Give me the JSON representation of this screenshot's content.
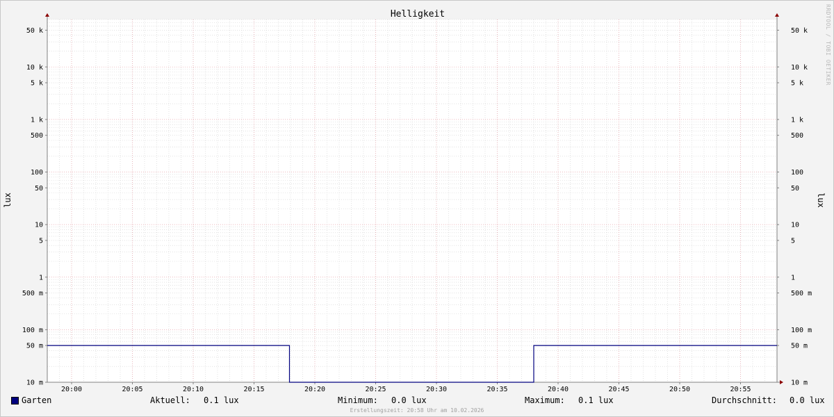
{
  "chart_data": {
    "type": "line",
    "title": "Helligkeit",
    "ylabel": "lux",
    "ylabel_right": "lux",
    "y_scale": "log",
    "ylim": [
      0.01,
      80000
    ],
    "y_ticks": [
      {
        "value": 50000,
        "label": "50 k"
      },
      {
        "value": 10000,
        "label": "10 k"
      },
      {
        "value": 5000,
        "label": "5 k"
      },
      {
        "value": 1000,
        "label": "1 k"
      },
      {
        "value": 500,
        "label": "500"
      },
      {
        "value": 100,
        "label": "100"
      },
      {
        "value": 50,
        "label": "50"
      },
      {
        "value": 10,
        "label": "10"
      },
      {
        "value": 5,
        "label": "5"
      },
      {
        "value": 1,
        "label": "1"
      },
      {
        "value": 0.5,
        "label": "500 m"
      },
      {
        "value": 0.1,
        "label": "100 m"
      },
      {
        "value": 0.05,
        "label": "50 m"
      },
      {
        "value": 0.01,
        "label": "10 m"
      }
    ],
    "xlim": [
      "19:58",
      "21:58"
    ],
    "x_ticks": [
      "20:00",
      "20:05",
      "20:10",
      "20:15",
      "20:20",
      "20:25",
      "20:30",
      "20:35",
      "20:40",
      "20:45",
      "20:50",
      "20:55"
    ],
    "grid": true,
    "series": [
      {
        "name": "Garten",
        "color": "#00007f",
        "points": [
          {
            "x": "19:58",
            "y": 0.05
          },
          {
            "x": "20:17:55",
            "y": 0.05
          },
          {
            "x": "20:17:55",
            "y": 0.01
          },
          {
            "x": "20:38:00",
            "y": 0.01
          },
          {
            "x": "20:38:00",
            "y": 0.05
          },
          {
            "x": "20:58",
            "y": 0.05
          }
        ]
      }
    ]
  },
  "legend": {
    "series_name": "Garten",
    "current_label": "Aktuell:",
    "current_value": "0.1 lux",
    "min_label": "Minimum:",
    "min_value": "0.0 lux",
    "max_label": "Maximum:",
    "max_value": "0.1 lux",
    "avg_label": "Durchschnitt:",
    "avg_value": "0.0 lux"
  },
  "footer": "Erstellungszeit: 20:58 Uhr am 10.02.2026",
  "watermark": "RRDTOOL / TOBI OETIKER",
  "colors": {
    "series": "#00007f",
    "major_grid": "#e8a0a8",
    "minor_grid": "#d0d0d0",
    "axis": "#808080",
    "arrow": "#8b0000"
  }
}
